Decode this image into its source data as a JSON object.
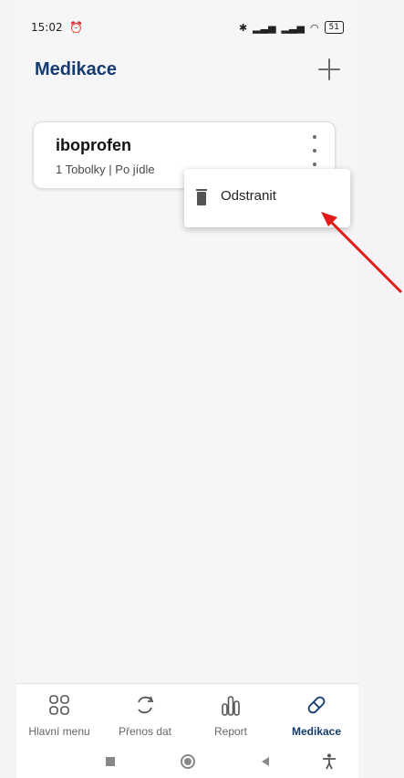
{
  "statusbar": {
    "time": "15:02",
    "battery": "51"
  },
  "header": {
    "title": "Medikace"
  },
  "medication": {
    "name": "iboprofen",
    "details": "1 Tobolky | Po jídle"
  },
  "menu": {
    "delete_label": "Odstranit"
  },
  "nav": {
    "items": [
      {
        "label": "Hlavní menu"
      },
      {
        "label": "Přenos dat"
      },
      {
        "label": "Report"
      },
      {
        "label": "Medikace"
      }
    ]
  },
  "colors": {
    "primary": "#163b6f",
    "arrow": "#e21b1b"
  }
}
